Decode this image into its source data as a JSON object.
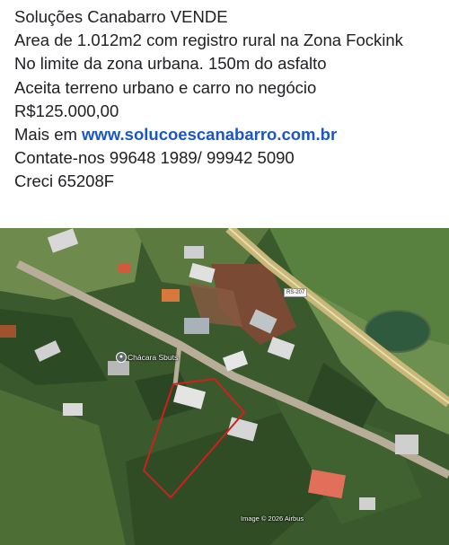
{
  "post": {
    "line1": "Soluções Canabarro VENDE",
    "line2": "Area de 1.012m2 com registro rural na Zona Fockink",
    "line3": "No limite da zona urbana. 150m do asfalto",
    "line4": "Aceita terreno urbano e carro no negócio",
    "line5": "R$125.000,00",
    "line6_prefix": "Mais em ",
    "line6_link": "www.solucoescanabarro.com.br",
    "line7": "Contate-nos 99648 1989/ 99942 5090",
    "line8": "Creci 65208F"
  },
  "map": {
    "road_badge": "RS-207",
    "poi_label": "Chácara Sbuts",
    "attribution": "Image © 2026 Airbus"
  },
  "colors": {
    "link": "#1a56c8",
    "lot_outline": "#d11f1f",
    "vegetation": "#36562b"
  }
}
